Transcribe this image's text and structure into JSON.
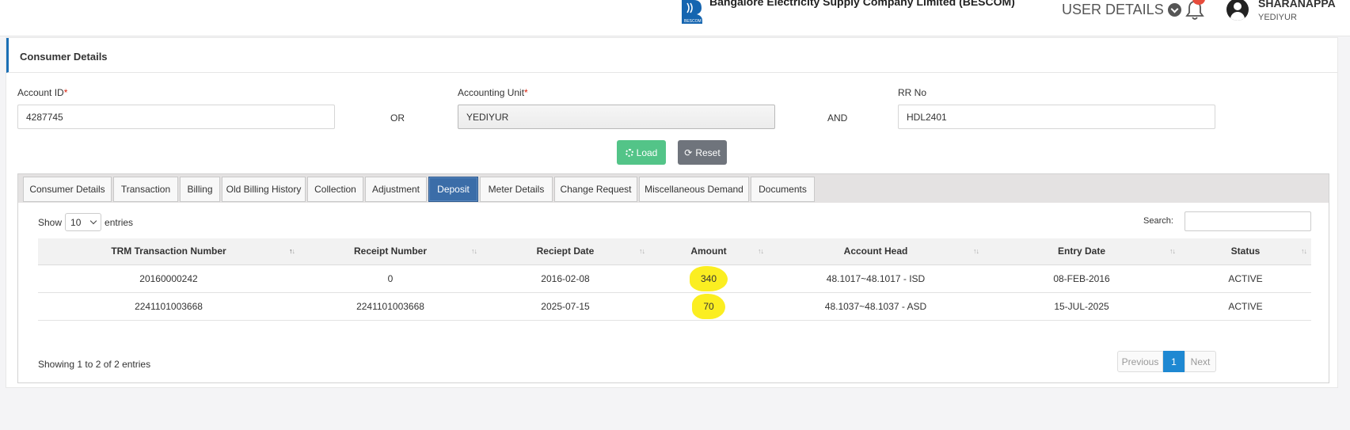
{
  "header": {
    "company": "Bangalore Electricity Supply Company Limited (BESCOM)",
    "user_details": "USER DETAILS",
    "user_name": "SHARANAPPA",
    "user_location": "YEDIYUR"
  },
  "panel": {
    "title": "Consumer Details"
  },
  "form": {
    "account_id_label": "Account ID",
    "account_id_value": "4287745",
    "or_text": "OR",
    "accounting_unit_label": "Accounting Unit",
    "accounting_unit_value": "YEDIYUR",
    "and_text": "AND",
    "rr_label": "RR No",
    "rr_value": "HDL2401",
    "required_mark": "*",
    "load_label": "Load",
    "reset_label": "Reset"
  },
  "tabs": [
    "Consumer Details",
    "Transaction",
    "Billing",
    "Old Billing History",
    "Collection",
    "Adjustment",
    "Deposit",
    "Meter Details",
    "Change Request",
    "Miscellaneous Demand",
    "Documents"
  ],
  "active_tab": "Deposit",
  "table_controls": {
    "show": "Show",
    "page_length": "10",
    "entries": "entries",
    "search_label": "Search:"
  },
  "table": {
    "columns": [
      "TRM Transaction Number",
      "Receipt Number",
      "Reciept Date",
      "Amount",
      "Account Head",
      "Entry Date",
      "Status"
    ],
    "rows": [
      [
        "20160000242",
        "0",
        "2016-02-08",
        "340",
        "48.1017~48.1017 - ISD",
        "08-FEB-2016",
        "ACTIVE"
      ],
      [
        "2241101003668",
        "2241101003668",
        "2025-07-15",
        "70",
        "48.1037~48.1037 - ASD",
        "15-JUL-2025",
        "ACTIVE"
      ]
    ],
    "info": "Showing 1 to 2 of 2 entries"
  },
  "pagination": {
    "previous": "Previous",
    "current": "1",
    "next": "Next"
  },
  "colors": {
    "active_tab": "#3b6da8",
    "load_button": "#53c488",
    "reset_button": "#6f747c",
    "highlight": "#fbee21",
    "page_current": "#1e88d2"
  }
}
